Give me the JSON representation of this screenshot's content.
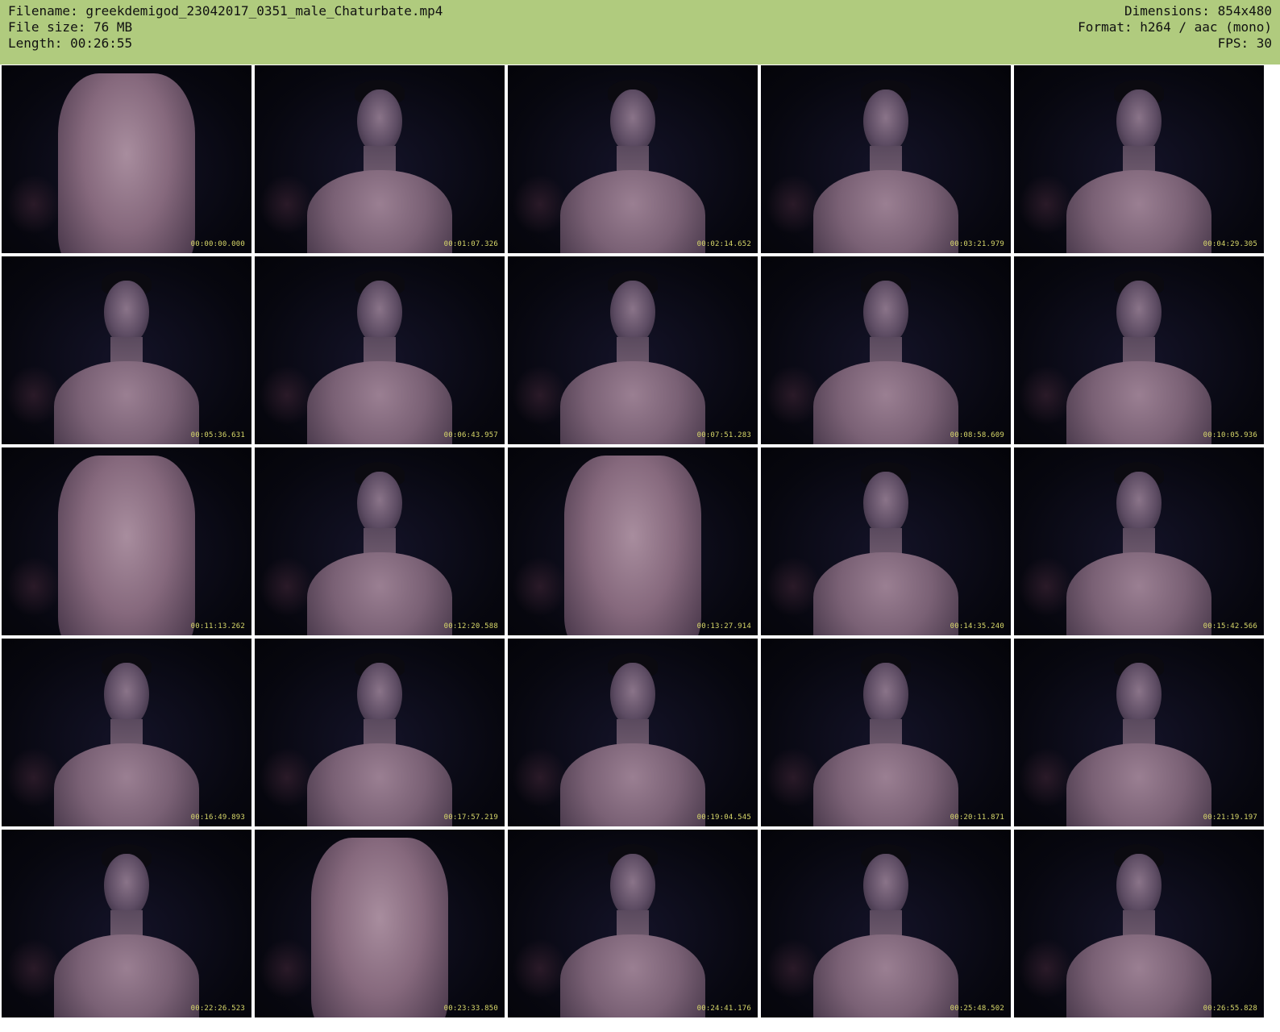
{
  "info": {
    "filename": "Filename: greekdemigod_23042017_0351_male_Chaturbate.mp4",
    "filesize": "File size: 76 MB",
    "length": "Length: 00:26:55",
    "dimensions": "Dimensions: 854x480",
    "format": "Format: h264 / aac (mono)",
    "fps": "FPS: 30"
  },
  "colors": {
    "header_bg": "#b0cb7e",
    "timestamp": "#d8d86a",
    "frame_bg": "#07070f"
  },
  "thumbnails": [
    {
      "timestamp": "00:00:00.000",
      "shot": "torso"
    },
    {
      "timestamp": "00:01:07.326",
      "shot": "face"
    },
    {
      "timestamp": "00:02:14.652",
      "shot": "face"
    },
    {
      "timestamp": "00:03:21.979",
      "shot": "face"
    },
    {
      "timestamp": "00:04:29.305",
      "shot": "face"
    },
    {
      "timestamp": "00:05:36.631",
      "shot": "face"
    },
    {
      "timestamp": "00:06:43.957",
      "shot": "face"
    },
    {
      "timestamp": "00:07:51.283",
      "shot": "face"
    },
    {
      "timestamp": "00:08:58.609",
      "shot": "face"
    },
    {
      "timestamp": "00:10:05.936",
      "shot": "face"
    },
    {
      "timestamp": "00:11:13.262",
      "shot": "torso"
    },
    {
      "timestamp": "00:12:20.588",
      "shot": "face"
    },
    {
      "timestamp": "00:13:27.914",
      "shot": "torso"
    },
    {
      "timestamp": "00:14:35.240",
      "shot": "face"
    },
    {
      "timestamp": "00:15:42.566",
      "shot": "face"
    },
    {
      "timestamp": "00:16:49.893",
      "shot": "face"
    },
    {
      "timestamp": "00:17:57.219",
      "shot": "face"
    },
    {
      "timestamp": "00:19:04.545",
      "shot": "face"
    },
    {
      "timestamp": "00:20:11.871",
      "shot": "face"
    },
    {
      "timestamp": "00:21:19.197",
      "shot": "face"
    },
    {
      "timestamp": "00:22:26.523",
      "shot": "face"
    },
    {
      "timestamp": "00:23:33.850",
      "shot": "torso"
    },
    {
      "timestamp": "00:24:41.176",
      "shot": "face"
    },
    {
      "timestamp": "00:25:48.502",
      "shot": "face"
    },
    {
      "timestamp": "00:26:55.828",
      "shot": "face"
    }
  ]
}
